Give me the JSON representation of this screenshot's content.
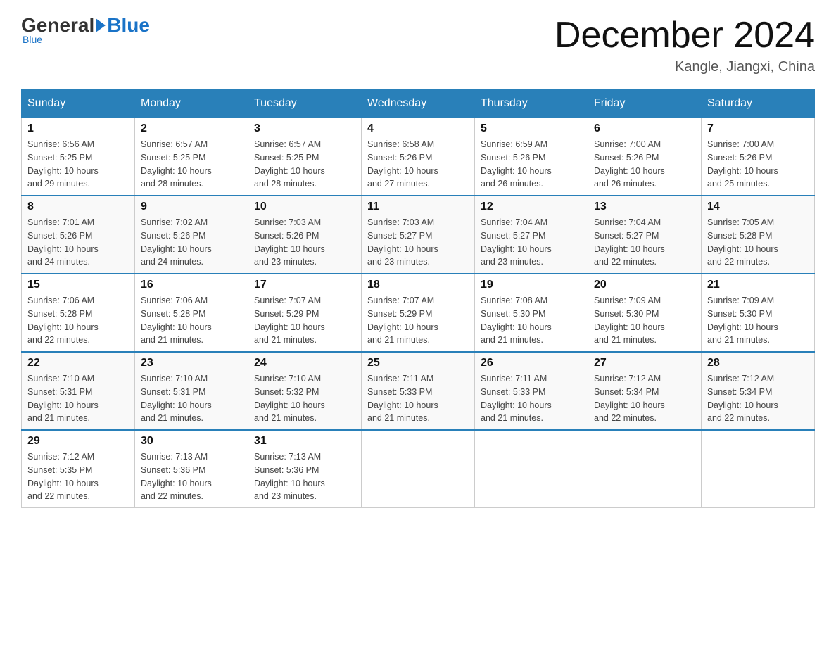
{
  "header": {
    "logo": {
      "general": "General",
      "blue": "Blue"
    },
    "title": "December 2024",
    "location": "Kangle, Jiangxi, China"
  },
  "weekdays": [
    "Sunday",
    "Monday",
    "Tuesday",
    "Wednesday",
    "Thursday",
    "Friday",
    "Saturday"
  ],
  "weeks": [
    [
      {
        "day": "1",
        "sunrise": "6:56 AM",
        "sunset": "5:25 PM",
        "daylight": "10 hours and 29 minutes."
      },
      {
        "day": "2",
        "sunrise": "6:57 AM",
        "sunset": "5:25 PM",
        "daylight": "10 hours and 28 minutes."
      },
      {
        "day": "3",
        "sunrise": "6:57 AM",
        "sunset": "5:25 PM",
        "daylight": "10 hours and 28 minutes."
      },
      {
        "day": "4",
        "sunrise": "6:58 AM",
        "sunset": "5:26 PM",
        "daylight": "10 hours and 27 minutes."
      },
      {
        "day": "5",
        "sunrise": "6:59 AM",
        "sunset": "5:26 PM",
        "daylight": "10 hours and 26 minutes."
      },
      {
        "day": "6",
        "sunrise": "7:00 AM",
        "sunset": "5:26 PM",
        "daylight": "10 hours and 26 minutes."
      },
      {
        "day": "7",
        "sunrise": "7:00 AM",
        "sunset": "5:26 PM",
        "daylight": "10 hours and 25 minutes."
      }
    ],
    [
      {
        "day": "8",
        "sunrise": "7:01 AM",
        "sunset": "5:26 PM",
        "daylight": "10 hours and 24 minutes."
      },
      {
        "day": "9",
        "sunrise": "7:02 AM",
        "sunset": "5:26 PM",
        "daylight": "10 hours and 24 minutes."
      },
      {
        "day": "10",
        "sunrise": "7:03 AM",
        "sunset": "5:26 PM",
        "daylight": "10 hours and 23 minutes."
      },
      {
        "day": "11",
        "sunrise": "7:03 AM",
        "sunset": "5:27 PM",
        "daylight": "10 hours and 23 minutes."
      },
      {
        "day": "12",
        "sunrise": "7:04 AM",
        "sunset": "5:27 PM",
        "daylight": "10 hours and 23 minutes."
      },
      {
        "day": "13",
        "sunrise": "7:04 AM",
        "sunset": "5:27 PM",
        "daylight": "10 hours and 22 minutes."
      },
      {
        "day": "14",
        "sunrise": "7:05 AM",
        "sunset": "5:28 PM",
        "daylight": "10 hours and 22 minutes."
      }
    ],
    [
      {
        "day": "15",
        "sunrise": "7:06 AM",
        "sunset": "5:28 PM",
        "daylight": "10 hours and 22 minutes."
      },
      {
        "day": "16",
        "sunrise": "7:06 AM",
        "sunset": "5:28 PM",
        "daylight": "10 hours and 21 minutes."
      },
      {
        "day": "17",
        "sunrise": "7:07 AM",
        "sunset": "5:29 PM",
        "daylight": "10 hours and 21 minutes."
      },
      {
        "day": "18",
        "sunrise": "7:07 AM",
        "sunset": "5:29 PM",
        "daylight": "10 hours and 21 minutes."
      },
      {
        "day": "19",
        "sunrise": "7:08 AM",
        "sunset": "5:30 PM",
        "daylight": "10 hours and 21 minutes."
      },
      {
        "day": "20",
        "sunrise": "7:09 AM",
        "sunset": "5:30 PM",
        "daylight": "10 hours and 21 minutes."
      },
      {
        "day": "21",
        "sunrise": "7:09 AM",
        "sunset": "5:30 PM",
        "daylight": "10 hours and 21 minutes."
      }
    ],
    [
      {
        "day": "22",
        "sunrise": "7:10 AM",
        "sunset": "5:31 PM",
        "daylight": "10 hours and 21 minutes."
      },
      {
        "day": "23",
        "sunrise": "7:10 AM",
        "sunset": "5:31 PM",
        "daylight": "10 hours and 21 minutes."
      },
      {
        "day": "24",
        "sunrise": "7:10 AM",
        "sunset": "5:32 PM",
        "daylight": "10 hours and 21 minutes."
      },
      {
        "day": "25",
        "sunrise": "7:11 AM",
        "sunset": "5:33 PM",
        "daylight": "10 hours and 21 minutes."
      },
      {
        "day": "26",
        "sunrise": "7:11 AM",
        "sunset": "5:33 PM",
        "daylight": "10 hours and 21 minutes."
      },
      {
        "day": "27",
        "sunrise": "7:12 AM",
        "sunset": "5:34 PM",
        "daylight": "10 hours and 22 minutes."
      },
      {
        "day": "28",
        "sunrise": "7:12 AM",
        "sunset": "5:34 PM",
        "daylight": "10 hours and 22 minutes."
      }
    ],
    [
      {
        "day": "29",
        "sunrise": "7:12 AM",
        "sunset": "5:35 PM",
        "daylight": "10 hours and 22 minutes."
      },
      {
        "day": "30",
        "sunrise": "7:13 AM",
        "sunset": "5:36 PM",
        "daylight": "10 hours and 22 minutes."
      },
      {
        "day": "31",
        "sunrise": "7:13 AM",
        "sunset": "5:36 PM",
        "daylight": "10 hours and 23 minutes."
      },
      null,
      null,
      null,
      null
    ]
  ],
  "labels": {
    "sunrise": "Sunrise:",
    "sunset": "Sunset:",
    "daylight": "Daylight:"
  }
}
